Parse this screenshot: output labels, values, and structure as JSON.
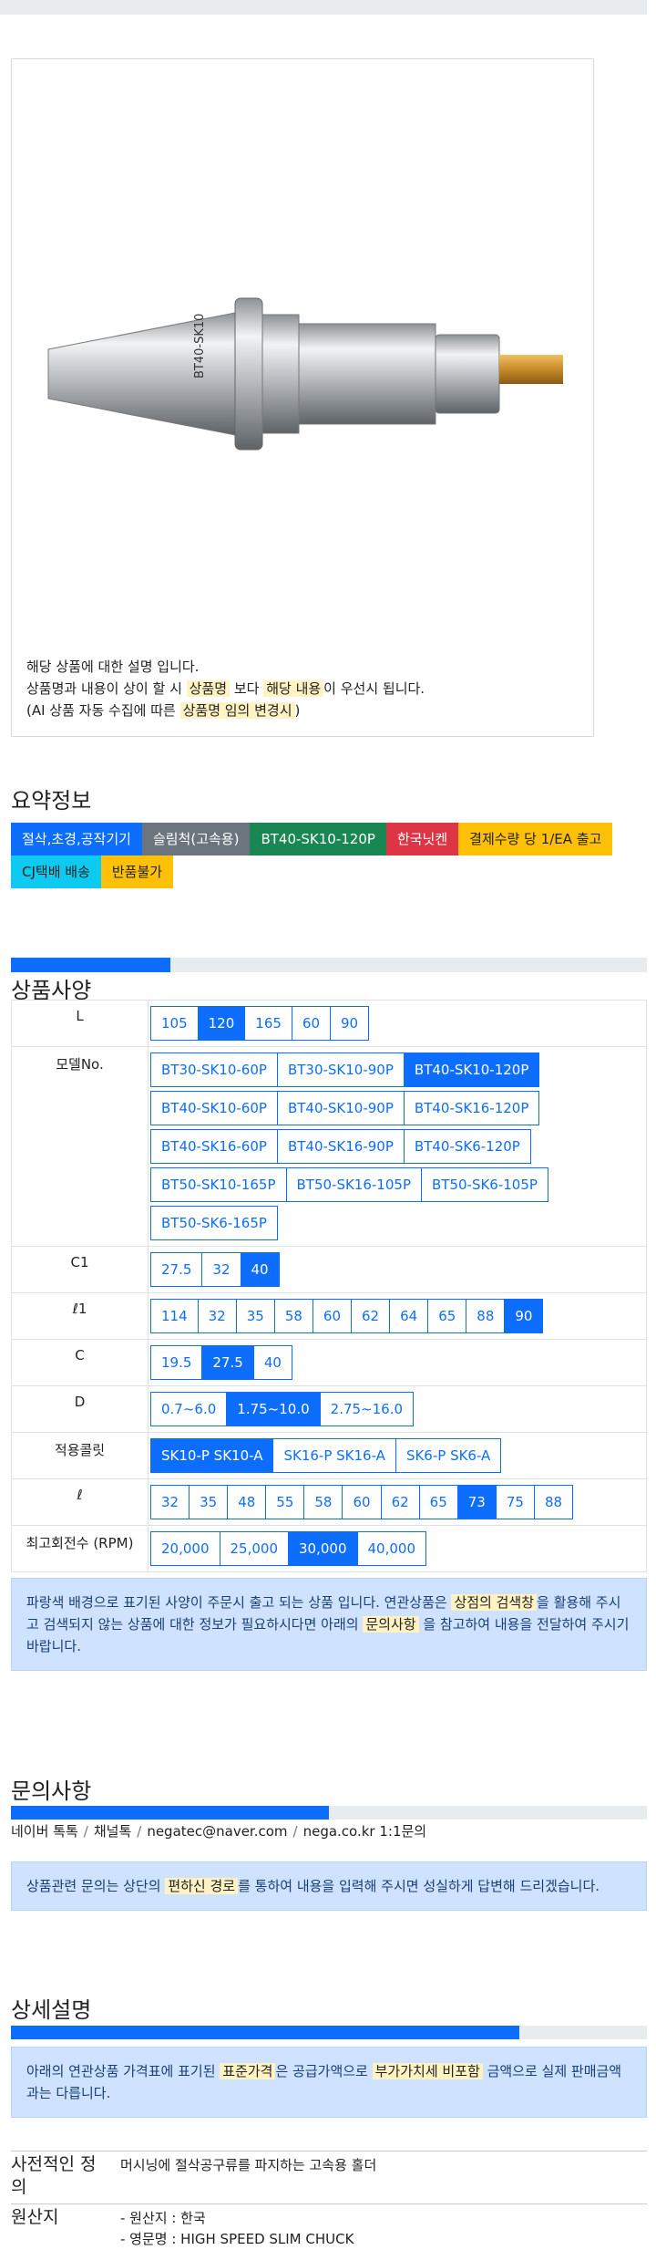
{
  "product_image": {
    "alt": "BT40-SK10 holder image",
    "engraving": "BT40-SK10"
  },
  "description": {
    "line1": "해당 상품에 대한 설명 입니다.",
    "line2_pre": "상품명과 내용이 상이 할 시 ",
    "line2_hl1": "상품명",
    "line2_mid": " 보다 ",
    "line2_hl2": "해당 내용",
    "line2_post": "이 우선시 됩니다.",
    "line3_pre": "(AI 상품 자동 수집에 따른 ",
    "line3_hl": "상품명 임의 변경시",
    "line3_post": ")"
  },
  "summary": {
    "title": "요약정보",
    "tags": [
      {
        "label": "절삭,초경,공작기기",
        "color": "#0d6efd",
        "text_color": "#ffffff"
      },
      {
        "label": "슬림척(고속용)",
        "color": "#6c757d",
        "text_color": "#ffffff"
      },
      {
        "label": "BT40-SK10-120P",
        "color": "#198754",
        "text_color": "#ffffff"
      },
      {
        "label": "한국닛켄",
        "color": "#dc3545",
        "text_color": "#ffffff"
      },
      {
        "label": "결제수량 당 1/EA 출고",
        "color": "#ffc107",
        "text_color": "#222222"
      },
      {
        "label": "CJ택배 배송",
        "color": "#0dcaf0",
        "text_color": "#222222"
      },
      {
        "label": "반품불가",
        "color": "#ffc107",
        "text_color": "#222222"
      }
    ]
  },
  "spec": {
    "title": "상품사양",
    "progress": 0.25,
    "rows": [
      {
        "label": "L",
        "options": [
          "105",
          "120",
          "165",
          "60",
          "90"
        ],
        "selected": "120"
      },
      {
        "label": "모델No.",
        "options": [
          "BT30-SK10-60P",
          "BT30-SK10-90P",
          "BT40-SK10-120P",
          "BT40-SK10-60P",
          "BT40-SK10-90P",
          "BT40-SK16-120P",
          "BT40-SK16-60P",
          "BT40-SK16-90P",
          "BT40-SK6-120P",
          "BT50-SK10-165P",
          "BT50-SK16-105P",
          "BT50-SK6-105P",
          "BT50-SK6-165P"
        ],
        "selected": "BT40-SK10-120P"
      },
      {
        "label": "C1",
        "options": [
          "27.5",
          "32",
          "40"
        ],
        "selected": "40"
      },
      {
        "label": "ℓ1",
        "options": [
          "114",
          "32",
          "35",
          "58",
          "60",
          "62",
          "64",
          "65",
          "88",
          "90"
        ],
        "selected": "90"
      },
      {
        "label": "C",
        "options": [
          "19.5",
          "27.5",
          "40"
        ],
        "selected": "27.5"
      },
      {
        "label": "D",
        "options": [
          "0.7~6.0",
          "1.75~10.0",
          "2.75~16.0"
        ],
        "selected": "1.75~10.0"
      },
      {
        "label": "적용콜릿",
        "options": [
          "SK10-P SK10-A",
          "SK16-P SK16-A",
          "SK6-P SK6-A"
        ],
        "selected": "SK10-P SK10-A"
      },
      {
        "label": "ℓ",
        "options": [
          "32",
          "35",
          "48",
          "55",
          "58",
          "60",
          "62",
          "65",
          "73",
          "75",
          "88"
        ],
        "selected": "73"
      },
      {
        "label": "최고회전수 (RPM)",
        "options": [
          "20,000",
          "25,000",
          "30,000",
          "40,000"
        ],
        "selected": "30,000"
      }
    ],
    "notice_pre": "파랑색 배경으로 표기된 사양이 주문시 출고 되는 상품 입니다. 연관상품은 ",
    "notice_hl1": "상점의 검색창",
    "notice_mid": "을 활용해 주시고 검색되지 않는 상품에 대한 정보가 필요하시다면 아래의 ",
    "notice_hl2": "문의사항",
    "notice_post": " 을 참고하여 내용을 전달하여 주시기 바랍니다."
  },
  "inquiry": {
    "title": "문의사항",
    "progress": 0.5,
    "contacts": [
      "네이버 톡톡",
      "채널톡",
      "negatec@naver.com",
      "nega.co.kr 1:1문의"
    ],
    "notice_pre": "상품관련 문의는 상단의 ",
    "notice_hl": "편하신 경로",
    "notice_post": "를 통하여 내용을 입력해 주시면 성실하게 답변해 드리겠습니다."
  },
  "detail": {
    "title": "상세설명",
    "progress": 0.8,
    "notice_pre": "아래의 연관상품 가격표에 표기된 ",
    "notice_hl1": "표준가격",
    "notice_mid": "은 공급가액으로 ",
    "notice_hl2": "부가가치세 비포함",
    "notice_post": " 금액으로 실제 판매금액과는 다릅니다.",
    "rows": [
      {
        "label": "사전적인 정의",
        "value": "머시닝에 절삭공구류를 파지하는 고속용 홀더"
      },
      {
        "label": "원산지",
        "value1": "- 원산지 : 한국",
        "value2": "- 영문명 : HIGH SPEED SLIM CHUCK"
      }
    ]
  }
}
